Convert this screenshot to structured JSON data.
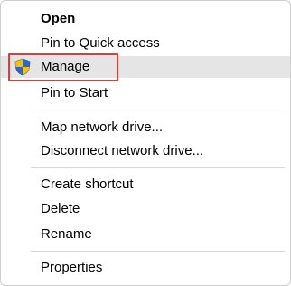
{
  "context_menu": {
    "items": [
      {
        "label": "Open"
      },
      {
        "label": "Pin to Quick access"
      },
      {
        "label": "Manage",
        "icon": "uac-shield-icon"
      },
      {
        "label": "Pin to Start"
      },
      {
        "label": "Map network drive..."
      },
      {
        "label": "Disconnect network drive..."
      },
      {
        "label": "Create shortcut"
      },
      {
        "label": "Delete"
      },
      {
        "label": "Rename"
      },
      {
        "label": "Properties"
      }
    ]
  },
  "colors": {
    "highlight_background": "#e5e5e5",
    "annotation_box": "#e53935"
  }
}
